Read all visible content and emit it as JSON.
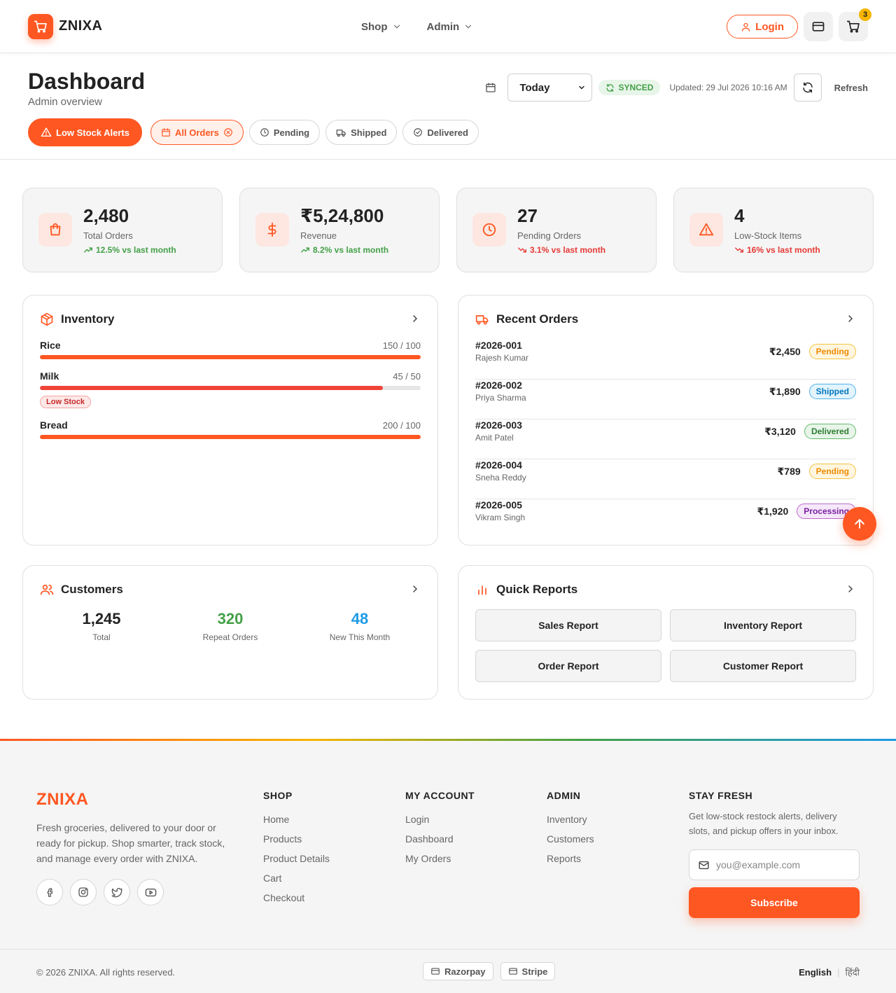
{
  "brand": {
    "name": "ZNIXA"
  },
  "nav": {
    "shop": "Shop",
    "admin": "Admin"
  },
  "header": {
    "login": "Login",
    "cart_count": "3"
  },
  "dashboard": {
    "title": "Dashboard",
    "subtitle": "Admin overview",
    "range": "Today",
    "sync_status": "SYNCED",
    "updated": "Updated: 29 Jul 2026 10:16 AM",
    "refresh": "Refresh"
  },
  "filters": {
    "low_stock": "Low Stock Alerts",
    "all_orders": "All Orders",
    "pending": "Pending",
    "shipped": "Shipped",
    "delivered": "Delivered"
  },
  "stats": [
    {
      "value": "2,480",
      "label": "Total Orders",
      "trend": "12.5% vs last month",
      "direction": "up",
      "icon": "shopping-bag-icon"
    },
    {
      "value": "₹5,24,800",
      "label": "Revenue",
      "trend": "8.2% vs last month",
      "direction": "up",
      "icon": "dollar-icon"
    },
    {
      "value": "27",
      "label": "Pending Orders",
      "trend": "3.1% vs last month",
      "direction": "down",
      "icon": "clock-icon"
    },
    {
      "value": "4",
      "label": "Low-Stock Items",
      "trend": "16% vs last month",
      "direction": "down",
      "icon": "warning-icon"
    }
  ],
  "inventory": {
    "title": "Inventory",
    "items": [
      {
        "name": "Rice",
        "qty": "150 / 100",
        "fill": 1.0
      },
      {
        "name": "Milk",
        "qty": "45 / 50",
        "fill": 0.9,
        "tag": "Low Stock"
      },
      {
        "name": "Bread",
        "qty": "200 / 100",
        "fill": 1.0
      }
    ]
  },
  "orders": {
    "title": "Recent Orders",
    "rows": [
      {
        "id": "#2026-001",
        "name": "Rajesh Kumar",
        "amount": "₹2,450",
        "status": "Pending"
      },
      {
        "id": "#2026-002",
        "name": "Priya Sharma",
        "amount": "₹1,890",
        "status": "Shipped"
      },
      {
        "id": "#2026-003",
        "name": "Amit Patel",
        "amount": "₹3,120",
        "status": "Delivered"
      },
      {
        "id": "#2026-004",
        "name": "Sneha Reddy",
        "amount": "₹789",
        "status": "Pending"
      },
      {
        "id": "#2026-005",
        "name": "Vikram Singh",
        "amount": "₹1,920",
        "status": "Processing"
      }
    ]
  },
  "customers": {
    "title": "Customers",
    "stats": [
      {
        "value": "1,245",
        "label": "Total",
        "color": "#222222"
      },
      {
        "value": "320",
        "label": "Repeat Orders",
        "color": "#43a047"
      },
      {
        "value": "48",
        "label": "New This Month",
        "color": "#1e9be6"
      }
    ]
  },
  "reports": {
    "title": "Quick Reports",
    "buttons": [
      "Sales Report",
      "Inventory Report",
      "Order Report",
      "Customer Report"
    ]
  },
  "footer": {
    "brand": "ZNIXA",
    "description": "Fresh groceries, delivered to your door or ready for pickup. Shop smarter, track stock, and manage every order with ZNIXA.",
    "shop": {
      "title": "SHOP",
      "links": [
        "Home",
        "Products",
        "Product Details",
        "Cart",
        "Checkout"
      ]
    },
    "account": {
      "title": "MY ACCOUNT",
      "links": [
        "Login",
        "Dashboard",
        "My Orders"
      ]
    },
    "admin": {
      "title": "ADMIN",
      "links": [
        "Inventory",
        "Customers",
        "Reports"
      ]
    },
    "newsletter": {
      "title": "STAY FRESH",
      "text": "Get low-stock restock alerts, delivery slots, and pickup offers in your inbox.",
      "placeholder": "you@example.com",
      "button": "Subscribe"
    },
    "copyright": "© 2026 ZNIXA. All rights reserved.",
    "payments": [
      "Razorpay",
      "Stripe"
    ],
    "languages": [
      "English",
      "हिंदी"
    ]
  },
  "colors": {
    "accent": "#ff5722",
    "success": "#43a047",
    "danger": "#e53935",
    "info": "#1e9be6"
  }
}
